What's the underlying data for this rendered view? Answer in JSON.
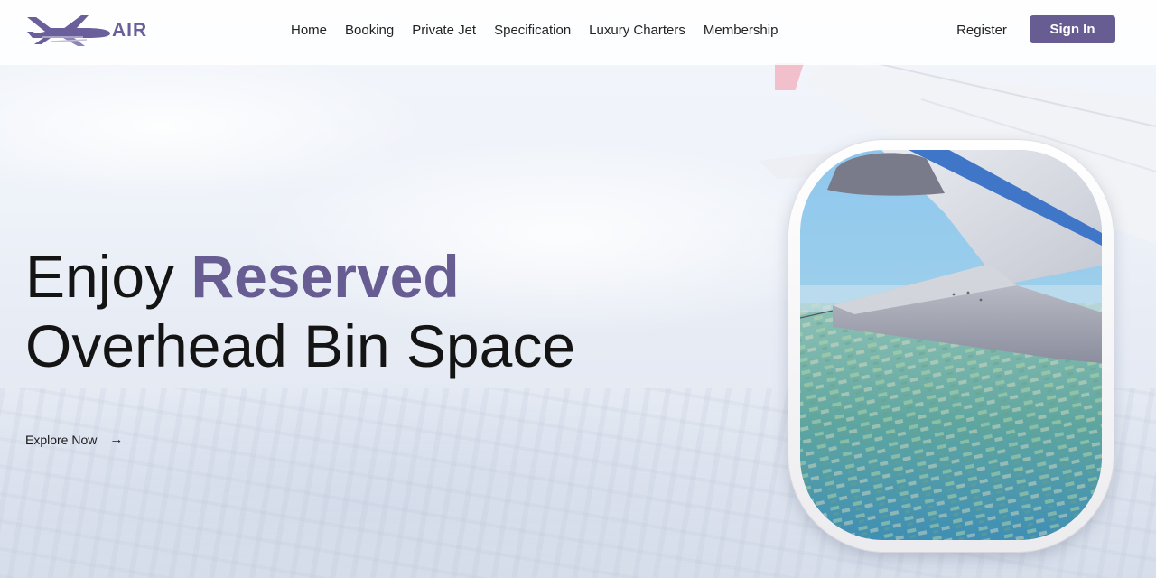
{
  "brand": {
    "name": "AIR",
    "logo_icon": "airplane-icon",
    "accent_color": "#675d92"
  },
  "nav": {
    "items": [
      {
        "label": "Home"
      },
      {
        "label": "Booking"
      },
      {
        "label": "Private Jet"
      },
      {
        "label": "Specification"
      },
      {
        "label": "Luxury Charters"
      },
      {
        "label": "Membership"
      }
    ],
    "register_label": "Register",
    "signin_label": "Sign In"
  },
  "hero": {
    "headline_part1": "Enjoy ",
    "headline_accent": "Reserved",
    "headline_line2": "Overhead Bin Space",
    "cta_label": "Explore Now",
    "cta_icon": "arrow-right-icon"
  }
}
